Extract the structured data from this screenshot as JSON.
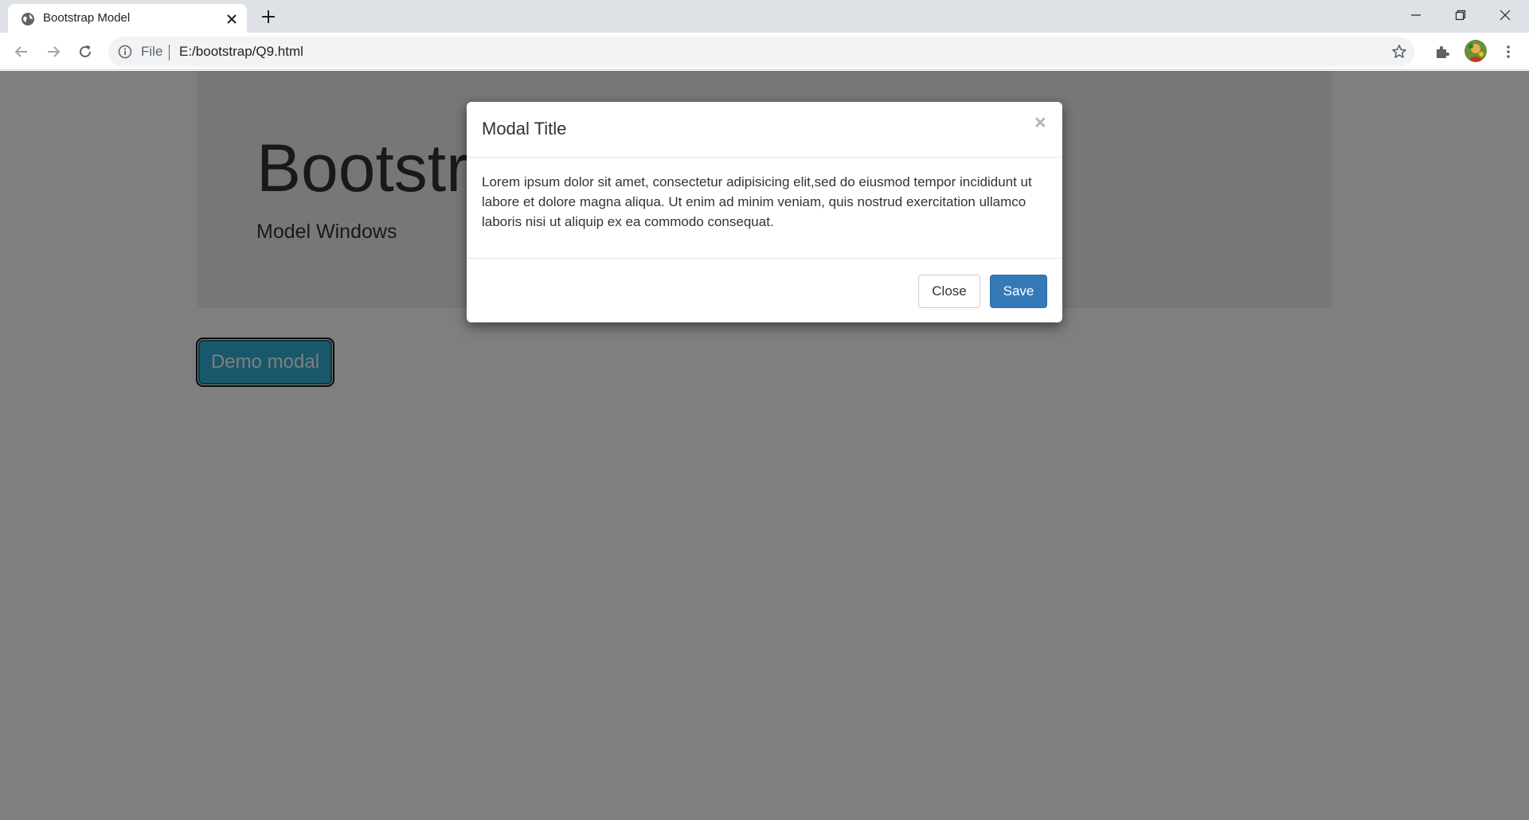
{
  "browser": {
    "tab": {
      "title": "Bootstrap Model",
      "favicon": "globe-icon",
      "close_icon": "close-icon"
    },
    "new_tab_icon": "plus-icon",
    "window_controls": [
      "minimize-icon",
      "restore-icon",
      "close-icon"
    ],
    "toolbar": {
      "back_icon": "back-arrow-icon",
      "forward_icon": "forward-arrow-icon",
      "reload_icon": "reload-icon",
      "info_icon": "info-icon",
      "scheme_label": "File",
      "url": "E:/bootstrap/Q9.html",
      "bookmark_icon": "star-icon",
      "extensions_icon": "puzzle-icon",
      "menu_icon": "kebab-menu-icon"
    }
  },
  "page": {
    "jumbotron": {
      "title": "Bootstrap Model",
      "subtitle": "Model Windows"
    },
    "demo_button_label": "Demo modal"
  },
  "modal": {
    "title": "Modal Title",
    "close_symbol": "×",
    "body": "Lorem ipsum dolor sit amet, consectetur adipisicing elit,sed do eiusmod tempor incididunt ut labore et dolore magna aliqua. Ut enim ad minim veniam, quis nostrud exercitation ullamco laboris nisi ut aliquip ex ea commodo consequat.",
    "close_button": "Close",
    "save_button": "Save"
  },
  "colors": {
    "primary": "#337ab7",
    "info": "#31b0d5",
    "jumbotron_bg": "#eeeeee",
    "backdrop": "rgba(0,0,0,0.5)"
  }
}
